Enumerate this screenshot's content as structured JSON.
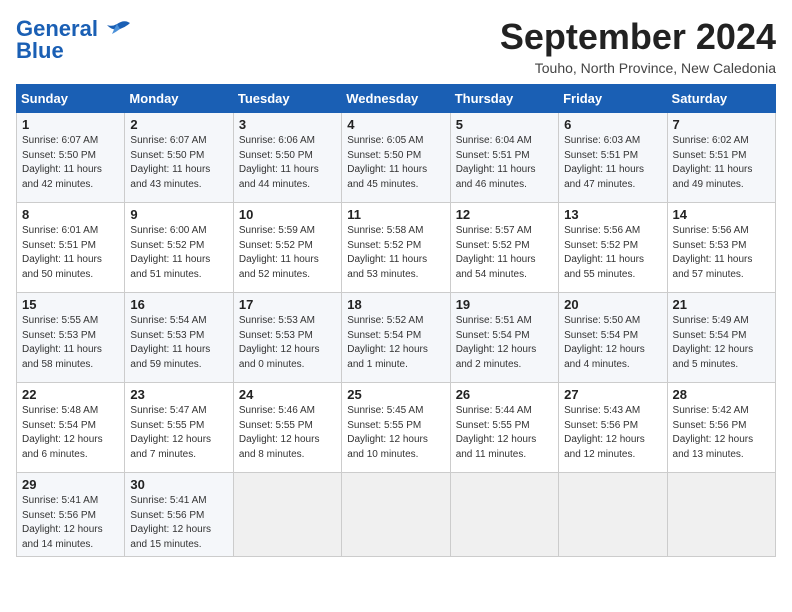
{
  "header": {
    "logo_general": "General",
    "logo_blue": "Blue",
    "month": "September 2024",
    "location": "Touho, North Province, New Caledonia"
  },
  "weekdays": [
    "Sunday",
    "Monday",
    "Tuesday",
    "Wednesday",
    "Thursday",
    "Friday",
    "Saturday"
  ],
  "weeks": [
    [
      {
        "day": "1",
        "sunrise": "6:07 AM",
        "sunset": "5:50 PM",
        "daylight": "11 hours and 42 minutes."
      },
      {
        "day": "2",
        "sunrise": "6:07 AM",
        "sunset": "5:50 PM",
        "daylight": "11 hours and 43 minutes."
      },
      {
        "day": "3",
        "sunrise": "6:06 AM",
        "sunset": "5:50 PM",
        "daylight": "11 hours and 44 minutes."
      },
      {
        "day": "4",
        "sunrise": "6:05 AM",
        "sunset": "5:50 PM",
        "daylight": "11 hours and 45 minutes."
      },
      {
        "day": "5",
        "sunrise": "6:04 AM",
        "sunset": "5:51 PM",
        "daylight": "11 hours and 46 minutes."
      },
      {
        "day": "6",
        "sunrise": "6:03 AM",
        "sunset": "5:51 PM",
        "daylight": "11 hours and 47 minutes."
      },
      {
        "day": "7",
        "sunrise": "6:02 AM",
        "sunset": "5:51 PM",
        "daylight": "11 hours and 49 minutes."
      }
    ],
    [
      {
        "day": "8",
        "sunrise": "6:01 AM",
        "sunset": "5:51 PM",
        "daylight": "11 hours and 50 minutes."
      },
      {
        "day": "9",
        "sunrise": "6:00 AM",
        "sunset": "5:52 PM",
        "daylight": "11 hours and 51 minutes."
      },
      {
        "day": "10",
        "sunrise": "5:59 AM",
        "sunset": "5:52 PM",
        "daylight": "11 hours and 52 minutes."
      },
      {
        "day": "11",
        "sunrise": "5:58 AM",
        "sunset": "5:52 PM",
        "daylight": "11 hours and 53 minutes."
      },
      {
        "day": "12",
        "sunrise": "5:57 AM",
        "sunset": "5:52 PM",
        "daylight": "11 hours and 54 minutes."
      },
      {
        "day": "13",
        "sunrise": "5:56 AM",
        "sunset": "5:52 PM",
        "daylight": "11 hours and 55 minutes."
      },
      {
        "day": "14",
        "sunrise": "5:56 AM",
        "sunset": "5:53 PM",
        "daylight": "11 hours and 57 minutes."
      }
    ],
    [
      {
        "day": "15",
        "sunrise": "5:55 AM",
        "sunset": "5:53 PM",
        "daylight": "11 hours and 58 minutes."
      },
      {
        "day": "16",
        "sunrise": "5:54 AM",
        "sunset": "5:53 PM",
        "daylight": "11 hours and 59 minutes."
      },
      {
        "day": "17",
        "sunrise": "5:53 AM",
        "sunset": "5:53 PM",
        "daylight": "12 hours and 0 minutes."
      },
      {
        "day": "18",
        "sunrise": "5:52 AM",
        "sunset": "5:54 PM",
        "daylight": "12 hours and 1 minute."
      },
      {
        "day": "19",
        "sunrise": "5:51 AM",
        "sunset": "5:54 PM",
        "daylight": "12 hours and 2 minutes."
      },
      {
        "day": "20",
        "sunrise": "5:50 AM",
        "sunset": "5:54 PM",
        "daylight": "12 hours and 4 minutes."
      },
      {
        "day": "21",
        "sunrise": "5:49 AM",
        "sunset": "5:54 PM",
        "daylight": "12 hours and 5 minutes."
      }
    ],
    [
      {
        "day": "22",
        "sunrise": "5:48 AM",
        "sunset": "5:54 PM",
        "daylight": "12 hours and 6 minutes."
      },
      {
        "day": "23",
        "sunrise": "5:47 AM",
        "sunset": "5:55 PM",
        "daylight": "12 hours and 7 minutes."
      },
      {
        "day": "24",
        "sunrise": "5:46 AM",
        "sunset": "5:55 PM",
        "daylight": "12 hours and 8 minutes."
      },
      {
        "day": "25",
        "sunrise": "5:45 AM",
        "sunset": "5:55 PM",
        "daylight": "12 hours and 10 minutes."
      },
      {
        "day": "26",
        "sunrise": "5:44 AM",
        "sunset": "5:55 PM",
        "daylight": "12 hours and 11 minutes."
      },
      {
        "day": "27",
        "sunrise": "5:43 AM",
        "sunset": "5:56 PM",
        "daylight": "12 hours and 12 minutes."
      },
      {
        "day": "28",
        "sunrise": "5:42 AM",
        "sunset": "5:56 PM",
        "daylight": "12 hours and 13 minutes."
      }
    ],
    [
      {
        "day": "29",
        "sunrise": "5:41 AM",
        "sunset": "5:56 PM",
        "daylight": "12 hours and 14 minutes."
      },
      {
        "day": "30",
        "sunrise": "5:41 AM",
        "sunset": "5:56 PM",
        "daylight": "12 hours and 15 minutes."
      },
      null,
      null,
      null,
      null,
      null
    ]
  ]
}
